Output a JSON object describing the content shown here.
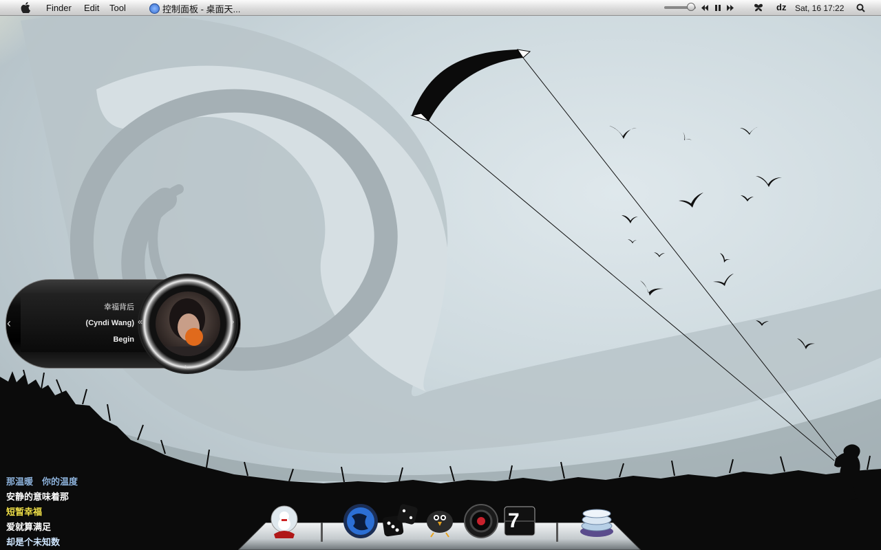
{
  "menubar": {
    "menus": [
      "Finder",
      "Edit",
      "Tool"
    ],
    "active_window": "控制面板 - 桌面天...",
    "clock": "Sat, 16 17:22",
    "tray_label": "dz"
  },
  "player": {
    "song": "幸福背后",
    "artist": "(Cyndi Wang)",
    "status": "Begin",
    "prev_glyph": "‹",
    "next_glyph": "›",
    "rewind_glyph": "«",
    "down_glyph": "›"
  },
  "lyrics": [
    {
      "text": "那温暖　你的温度",
      "color": "#8fb4dd"
    },
    {
      "text": "安静的意味着那",
      "color": "#ffffff"
    },
    {
      "text": "短暂幸福",
      "color": "#f2e24a"
    },
    {
      "text": "爱就算满足",
      "color": "#ffffff"
    },
    {
      "text": "却是个未知数",
      "color": "#cfe6ff"
    }
  ],
  "dock": {
    "items": [
      "snow-globe",
      "browser-globe",
      "dice",
      "twitter-bird",
      "camera-lens",
      "calendar",
      "stack"
    ],
    "calendar_text": "7"
  },
  "colors": {
    "sky": "#cfdadf",
    "spiral": "#a9b3b8",
    "silhouette": "#0b0b0b"
  }
}
